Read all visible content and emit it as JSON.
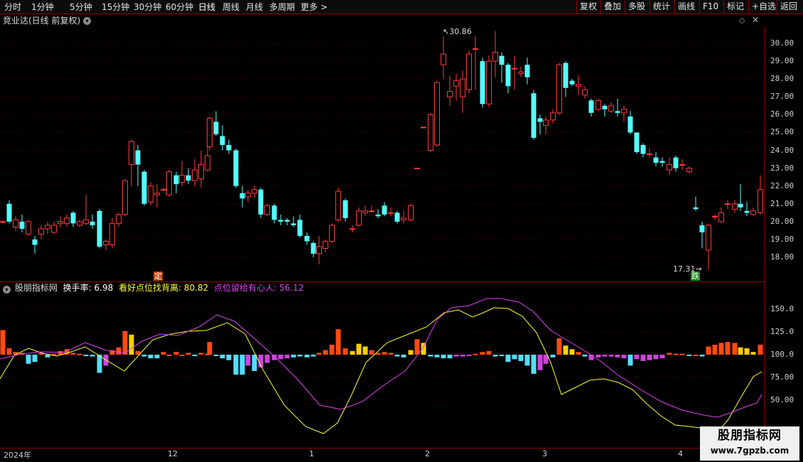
{
  "toolbar": {
    "left_items": [
      "分时",
      "1分钟",
      "5分钟",
      "15分钟",
      "30分钟",
      "60分钟",
      "日线",
      "周线",
      "月线",
      "多周期",
      "更多 >"
    ],
    "active_item": "日线",
    "right_items": [
      "复权",
      "叠加",
      "多股",
      "统计",
      "画线",
      "F10",
      "标记",
      "+自选",
      "返回"
    ]
  },
  "title": "竞业达(日线 前复权)",
  "indicator": {
    "name": "股朋指标网",
    "label1": "换手率: 6.98",
    "label2": "看好点位找背离: 80.82",
    "label3": "点位留给有心人: 56.12",
    "color1": "#ffffff",
    "color2": "#ffff33",
    "color3": "#dd44ee"
  },
  "price_axis": [
    "30.00",
    "29.00",
    "28.00",
    "27.00",
    "26.00",
    "25.00",
    "24.00",
    "23.00",
    "22.00",
    "21.00",
    "20.00",
    "19.00",
    "18.00"
  ],
  "indicator_axis": [
    "150.0",
    "125.0",
    "100.0",
    "75.00",
    "50.00"
  ],
  "time_axis": [
    "2024年",
    "12",
    "1",
    "2",
    "3",
    "4"
  ],
  "annotations": {
    "high": "30.86",
    "low": "17.31",
    "mark_ding": "定",
    "mark_die": "跌"
  },
  "colors": {
    "up": "#ff3b3b",
    "down": "#54ffff",
    "grid": "#8b0000"
  },
  "watermark": {
    "line1": "股朋指标网",
    "line2": "www.7gpzb.com"
  }
}
